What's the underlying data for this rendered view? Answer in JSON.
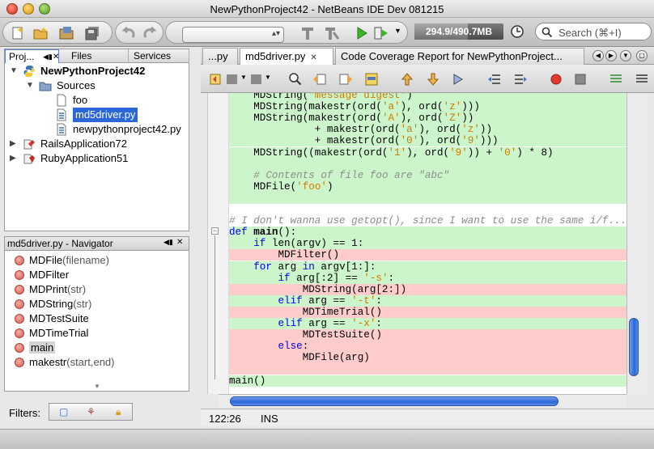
{
  "window": {
    "title": "NewPythonProject42 - NetBeans IDE Dev 081215"
  },
  "toolbar": {
    "memory": "294.9/490.7MB",
    "memory_fraction": 0.6,
    "search_placeholder": "Search (⌘+I)"
  },
  "project_pane": {
    "tabs": [
      "Proj...",
      "Files",
      "Services"
    ],
    "tree": [
      {
        "label": "NewPythonProject42",
        "level": 0,
        "expanded": true,
        "bold": true
      },
      {
        "label": "Sources",
        "level": 1,
        "expanded": true
      },
      {
        "label": "foo",
        "level": 2
      },
      {
        "label": "md5driver.py",
        "level": 2,
        "selected": true
      },
      {
        "label": "newpythonproject42.py",
        "level": 2
      },
      {
        "label": "RailsApplication72",
        "level": 0,
        "expanded": false
      },
      {
        "label": "RubyApplication51",
        "level": 0,
        "expanded": false
      }
    ]
  },
  "navigator": {
    "title": "md5driver.py - Navigator",
    "items": [
      {
        "name": "MDFile",
        "params": "(filename)"
      },
      {
        "name": "MDFilter",
        "params": ""
      },
      {
        "name": "MDPrint",
        "params": "(str)"
      },
      {
        "name": "MDString",
        "params": "(str)"
      },
      {
        "name": "MDTestSuite",
        "params": ""
      },
      {
        "name": "MDTimeTrial",
        "params": ""
      },
      {
        "name": "main",
        "params": "",
        "selected": true
      },
      {
        "name": "makestr",
        "params": "(start,end)"
      }
    ],
    "filters_label": "Filters:"
  },
  "editor": {
    "tabs": [
      {
        "label": "...py",
        "close": false
      },
      {
        "label": "md5driver.py",
        "close": true,
        "active": true
      },
      {
        "label": "Code Coverage Report for NewPythonProject...",
        "close": false
      }
    ],
    "lines": [
      {
        "text": "    MDString(\"message digest\")",
        "cov": "g"
      },
      {
        "text": "    MDString(makestr(ord('a'), ord('z')))",
        "cov": "g"
      },
      {
        "text": "    MDString(makestr(ord('A'), ord('Z'))",
        "cov": "g"
      },
      {
        "text": "              + makestr(ord('a'), ord('z'))",
        "cov": "g"
      },
      {
        "text": "              + makestr(ord('0'), ord('9')))",
        "cov": "g"
      },
      {
        "text": "    MDString((makestr(ord('1'), ord('9')) + '0') * 8)",
        "cov": "g"
      },
      {
        "text": "",
        "cov": "g"
      },
      {
        "text": "    # Contents of file foo are \"abc\"",
        "cov": "g"
      },
      {
        "text": "    MDFile('foo')",
        "cov": "g"
      },
      {
        "text": "",
        "cov": "g"
      },
      {
        "text": "",
        "cov": ""
      },
      {
        "text": "# I don't wanna use getopt(), since I want to use the same i/f...",
        "cov": ""
      },
      {
        "text": "def main():",
        "cov": "g"
      },
      {
        "text": "    if len(argv) == 1:",
        "cov": "g"
      },
      {
        "text": "        MDFilter()",
        "cov": "r"
      },
      {
        "text": "    for arg in argv[1:]:",
        "cov": "g"
      },
      {
        "text": "        if arg[:2] == '-s':",
        "cov": "g"
      },
      {
        "text": "            MDString(arg[2:])",
        "cov": "r"
      },
      {
        "text": "        elif arg == '-t':",
        "cov": "g"
      },
      {
        "text": "            MDTimeTrial()",
        "cov": "r"
      },
      {
        "text": "        elif arg == '-x':",
        "cov": "g"
      },
      {
        "text": "            MDTestSuite()",
        "cov": "r"
      },
      {
        "text": "        else:",
        "cov": "r"
      },
      {
        "text": "            MDFile(arg)",
        "cov": "r"
      },
      {
        "text": "",
        "cov": "r"
      },
      {
        "text": "main()",
        "cov": "g"
      }
    ]
  },
  "status": {
    "position": "122:26",
    "mode": "INS"
  }
}
